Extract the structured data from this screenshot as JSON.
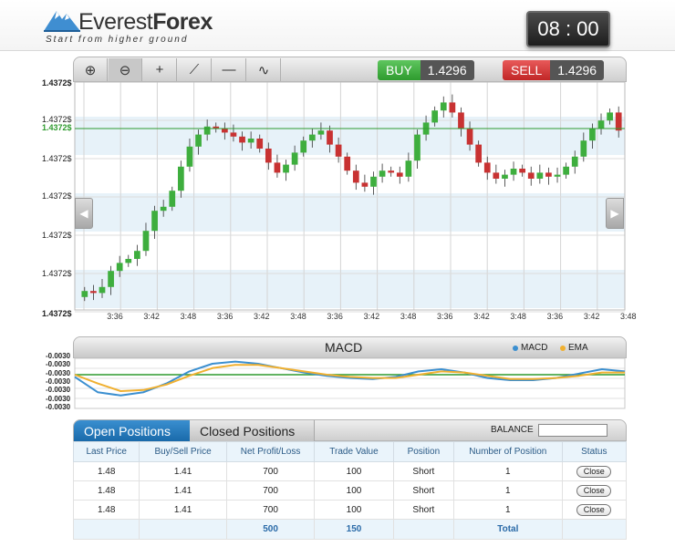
{
  "header": {
    "logo_name": "Everest",
    "logo_name_bold": "Forex",
    "tagline": "Start from higher ground",
    "clock": "08 : 00"
  },
  "toolbar": {
    "tools": [
      {
        "name": "zoom-in-icon",
        "glyph": "⊕"
      },
      {
        "name": "zoom-out-icon",
        "glyph": "⊖"
      },
      {
        "name": "crosshair-icon",
        "glyph": "+"
      },
      {
        "name": "trend-line-icon",
        "glyph": "⟋"
      },
      {
        "name": "horizontal-line-icon",
        "glyph": "—"
      },
      {
        "name": "curve-icon",
        "glyph": "∿"
      }
    ],
    "buy_label": "BUY",
    "buy_price": "1.4296",
    "sell_label": "SELL",
    "sell_price": "1.4296"
  },
  "chart_data": [
    {
      "type": "candlestick",
      "title": "",
      "y_tick_labels": [
        "1.4372$",
        "1.4372$",
        "1.4372$",
        "1.4372$",
        "1.4372$",
        "1.4372$",
        "1.4372$",
        "1.4372$"
      ],
      "current_price_label": "1.4372$",
      "x_tick_labels": [
        "3:36",
        "3:42",
        "3:48",
        "3:36",
        "3:42",
        "3:48",
        "3:36",
        "3:42",
        "3:48",
        "3:36",
        "3:42",
        "3:48",
        "3:36",
        "3:42",
        "3:48"
      ],
      "closes": [
        0.04,
        0.03,
        0.06,
        0.14,
        0.18,
        0.2,
        0.24,
        0.34,
        0.44,
        0.46,
        0.54,
        0.66,
        0.76,
        0.82,
        0.86,
        0.85,
        0.83,
        0.81,
        0.78,
        0.8,
        0.75,
        0.68,
        0.63,
        0.67,
        0.73,
        0.79,
        0.82,
        0.84,
        0.77,
        0.71,
        0.64,
        0.58,
        0.56,
        0.61,
        0.64,
        0.63,
        0.61,
        0.69,
        0.82,
        0.88,
        0.94,
        0.98,
        0.93,
        0.85,
        0.77,
        0.68,
        0.63,
        0.6,
        0.62,
        0.65,
        0.63,
        0.6,
        0.63,
        0.61,
        0.62,
        0.66,
        0.71,
        0.79,
        0.85,
        0.89,
        0.93,
        0.84
      ],
      "colors": {
        "up": "#3eae3e",
        "down": "#c83232",
        "reference_line": "#2e9a2e",
        "band": "#e7f2f9"
      }
    },
    {
      "type": "line",
      "title": "MACD",
      "y_tick_labels": [
        "-0.0030",
        "-0.0030",
        "-0.0030",
        "-0.0030",
        "-0.0030",
        "-0.0030",
        "-0.0030"
      ],
      "series": [
        {
          "name": "MACD",
          "color": "#3b8fd0",
          "values": [
            -0.2,
            -1.6,
            -1.9,
            -1.6,
            -0.8,
            0.3,
            1.0,
            1.2,
            1.0,
            0.6,
            0.2,
            -0.1,
            -0.3,
            -0.4,
            -0.2,
            0.3,
            0.5,
            0.2,
            -0.3,
            -0.5,
            -0.5,
            -0.3,
            0.1,
            0.5,
            0.3
          ]
        },
        {
          "name": "EMA",
          "color": "#f0b030",
          "values": [
            0.0,
            -0.8,
            -1.5,
            -1.4,
            -0.9,
            -0.1,
            0.6,
            0.9,
            0.9,
            0.6,
            0.3,
            0.0,
            -0.2,
            -0.3,
            -0.3,
            0.0,
            0.3,
            0.2,
            -0.1,
            -0.4,
            -0.4,
            -0.3,
            -0.1,
            0.2,
            0.2
          ]
        }
      ],
      "reference_color": "#2e9a2e"
    }
  ],
  "positions": {
    "tab_open": "Open Positions",
    "tab_closed": "Closed Positions",
    "balance_label": "BALANCE",
    "columns": [
      "Last Price",
      "Buy/Sell Price",
      "Net Profit/Loss",
      "Trade Value",
      "Position",
      "Number of Position",
      "Status"
    ],
    "rows": [
      [
        "1.48",
        "1.41",
        "700",
        "100",
        "Short",
        "1",
        "Close"
      ],
      [
        "1.48",
        "1.41",
        "700",
        "100",
        "Short",
        "1",
        "Close"
      ],
      [
        "1.48",
        "1.41",
        "700",
        "100",
        "Short",
        "1",
        "Close"
      ]
    ],
    "totals": [
      "",
      "",
      "500",
      "150",
      "",
      "Total",
      ""
    ]
  }
}
